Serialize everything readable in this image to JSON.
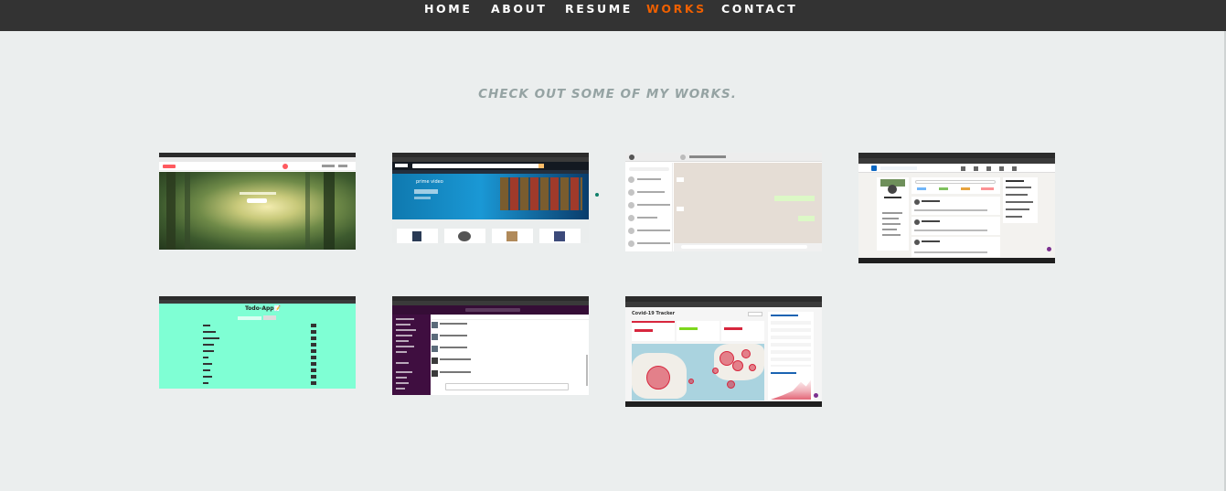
{
  "nav": {
    "items": [
      "HOME",
      "ABOUT",
      "RESUME",
      "WORKS",
      "CONTACT"
    ],
    "active": "WORKS"
  },
  "works": {
    "title": "CHECK OUT SOME OF MY WORKS.",
    "todo_app_title": "Todo-App📝",
    "covid_title": "Covid-19 Tracker",
    "prime_video_label": "prime video"
  },
  "colors": {
    "nav_bg": "#333333",
    "nav_active": "#f06000",
    "page_bg": "#ebeeee",
    "title": "#95a3a3",
    "todo_bg": "#7fffd4",
    "slack_sidebar": "#3f0e40",
    "covid_red": "#d7263d"
  }
}
